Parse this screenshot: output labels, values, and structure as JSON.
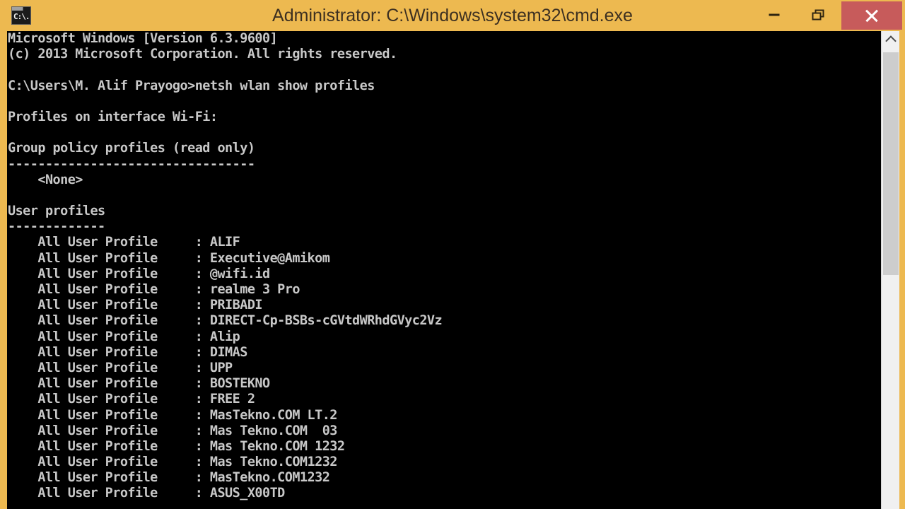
{
  "window": {
    "title": "Administrator: C:\\Windows\\system32\\cmd.exe",
    "icon_label": "C:\\.",
    "titlebar_color": "#edb950",
    "close_button_color": "#c75b5b",
    "console_background": "#000000",
    "console_foreground": "#c8c8c8"
  },
  "titlebar_buttons": {
    "minimize": "Minimize",
    "maximize": "Restore Down",
    "close": "Close"
  },
  "scrollbar": {
    "up_arrow": "Scroll up"
  },
  "console": {
    "lines": [
      "Microsoft Windows [Version 6.3.9600]",
      "(c) 2013 Microsoft Corporation. All rights reserved.",
      "",
      "C:\\Users\\M. Alif Prayogo>netsh wlan show profiles",
      "",
      "Profiles on interface Wi-Fi:",
      "",
      "Group policy profiles (read only)",
      "---------------------------------",
      "    <None>",
      "",
      "User profiles",
      "-------------",
      "    All User Profile     : ALIF",
      "    All User Profile     : Executive@Amikom",
      "    All User Profile     : @wifi.id",
      "    All User Profile     : realme 3 Pro",
      "    All User Profile     : PRIBADI",
      "    All User Profile     : DIRECT-Cp-BSBs-cGVtdWRhdGVyc2Vz",
      "    All User Profile     : Alip",
      "    All User Profile     : DIMAS",
      "    All User Profile     : UPP",
      "    All User Profile     : BOSTEKNO",
      "    All User Profile     : FREE 2",
      "    All User Profile     : MasTekno.COM LT.2",
      "    All User Profile     : Mas Tekno.COM  03",
      "    All User Profile     : Mas Tekno.COM 1232",
      "    All User Profile     : Mas Tekno.COM1232",
      "    All User Profile     : MasTekno.COM1232",
      "    All User Profile     : ASUS_X00TD"
    ],
    "command": "netsh wlan show profiles",
    "prompt": "C:\\Users\\M. Alif Prayogo>",
    "interface": "Wi-Fi",
    "group_policy_profiles": [
      "<None>"
    ],
    "user_profiles": [
      "ALIF",
      "Executive@Amikom",
      "@wifi.id",
      "realme 3 Pro",
      "PRIBADI",
      "DIRECT-Cp-BSBs-cGVtdWRhdGVyc2Vz",
      "Alip",
      "DIMAS",
      "UPP",
      "BOSTEKNO",
      "FREE 2",
      "MasTekno.COM LT.2",
      "Mas Tekno.COM  03",
      "Mas Tekno.COM 1232",
      "Mas Tekno.COM1232",
      "MasTekno.COM1232",
      "ASUS_X00TD"
    ]
  }
}
